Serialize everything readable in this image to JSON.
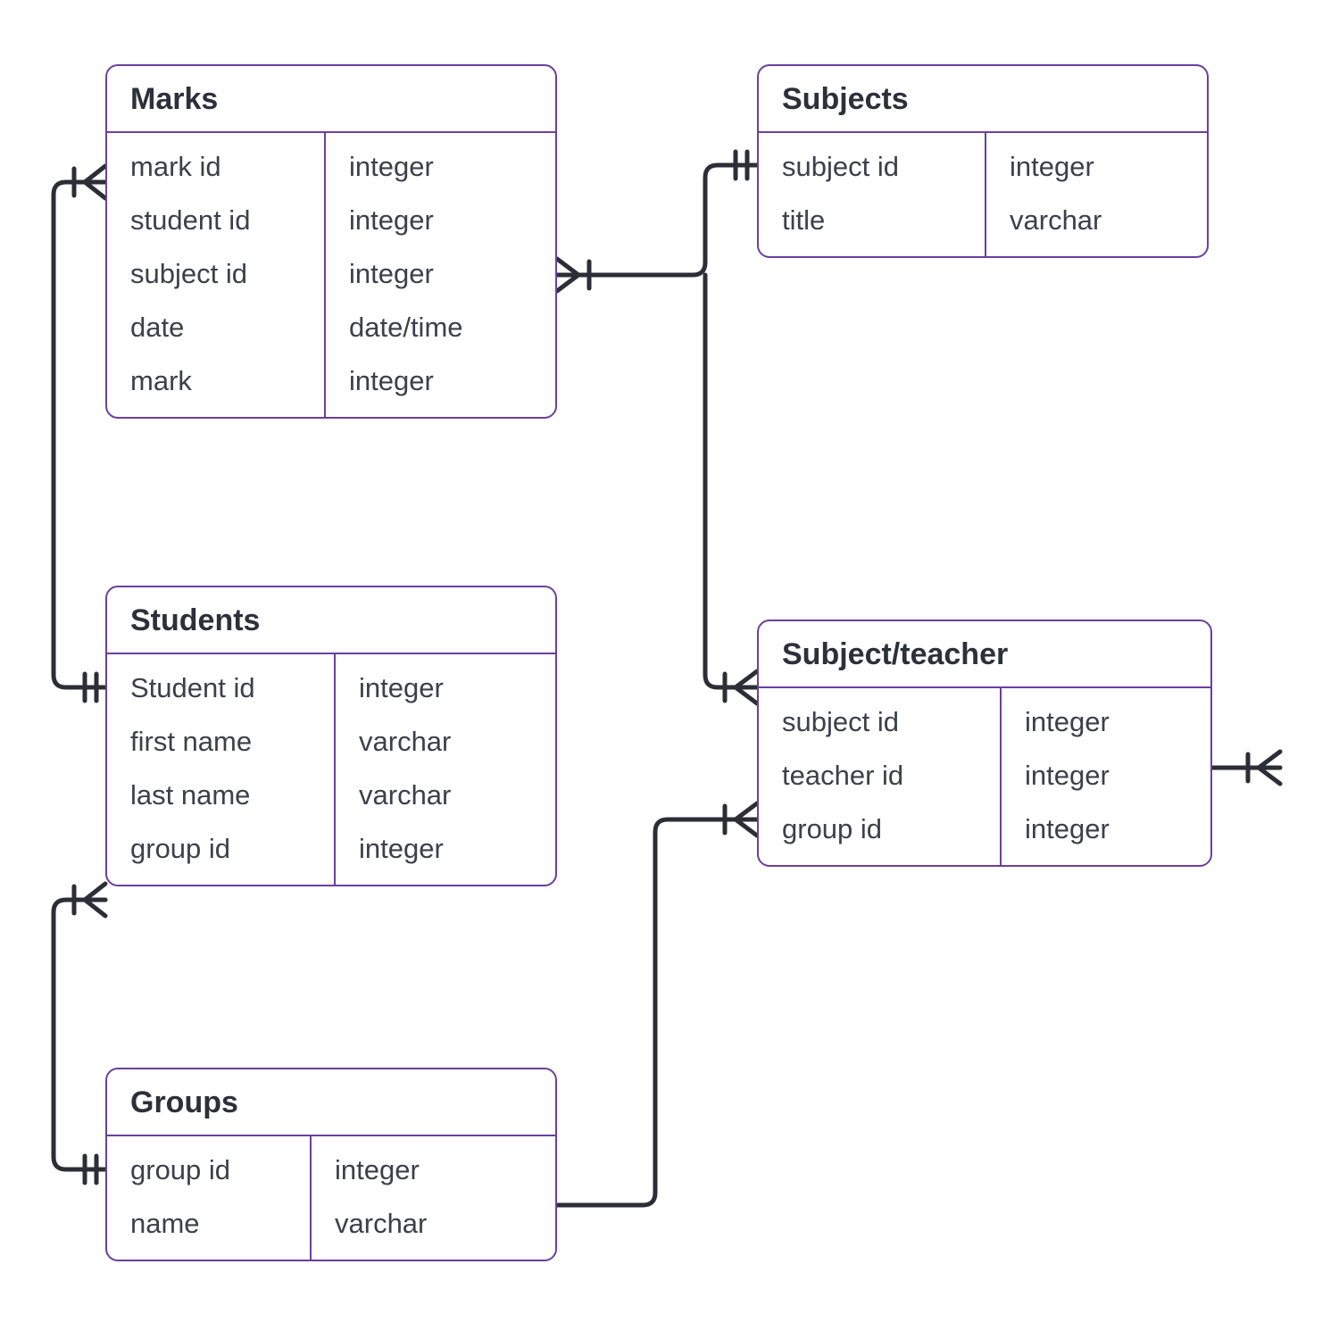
{
  "entities": {
    "marks": {
      "title": "Marks",
      "fields": [
        {
          "name": "mark id",
          "type": "integer"
        },
        {
          "name": "student id",
          "type": "integer"
        },
        {
          "name": "subject id",
          "type": "integer"
        },
        {
          "name": "date",
          "type": "date/time"
        },
        {
          "name": "mark",
          "type": "integer"
        }
      ]
    },
    "subjects": {
      "title": "Subjects",
      "fields": [
        {
          "name": "subject id",
          "type": "integer"
        },
        {
          "name": "title",
          "type": "varchar"
        }
      ]
    },
    "students": {
      "title": "Students",
      "fields": [
        {
          "name": "Student id",
          "type": "integer"
        },
        {
          "name": "first name",
          "type": "varchar"
        },
        {
          "name": "last name",
          "type": "varchar"
        },
        {
          "name": "group id",
          "type": "integer"
        }
      ]
    },
    "subject_teacher": {
      "title": "Subject/teacher",
      "fields": [
        {
          "name": "subject id",
          "type": "integer"
        },
        {
          "name": "teacher id",
          "type": "integer"
        },
        {
          "name": "group id",
          "type": "integer"
        }
      ]
    },
    "groups": {
      "title": "Groups",
      "fields": [
        {
          "name": "group id",
          "type": "integer"
        },
        {
          "name": "name",
          "type": "varchar"
        }
      ]
    }
  },
  "relationships": [
    {
      "from": "students",
      "to": "marks",
      "type": "one-to-many"
    },
    {
      "from": "subjects",
      "to": "marks",
      "type": "one-to-many"
    },
    {
      "from": "subjects",
      "to": "subject_teacher",
      "type": "one-to-many"
    },
    {
      "from": "groups",
      "to": "subject_teacher",
      "type": "one-to-many"
    },
    {
      "from": "groups",
      "to": "students",
      "type": "one-to-many"
    },
    {
      "from": "subject_teacher",
      "to": "external",
      "type": "many"
    }
  ],
  "colors": {
    "border": "#6b3fa0",
    "text_dark": "#2b303a",
    "text_body": "#3c404a",
    "connector": "#2b2e36"
  }
}
